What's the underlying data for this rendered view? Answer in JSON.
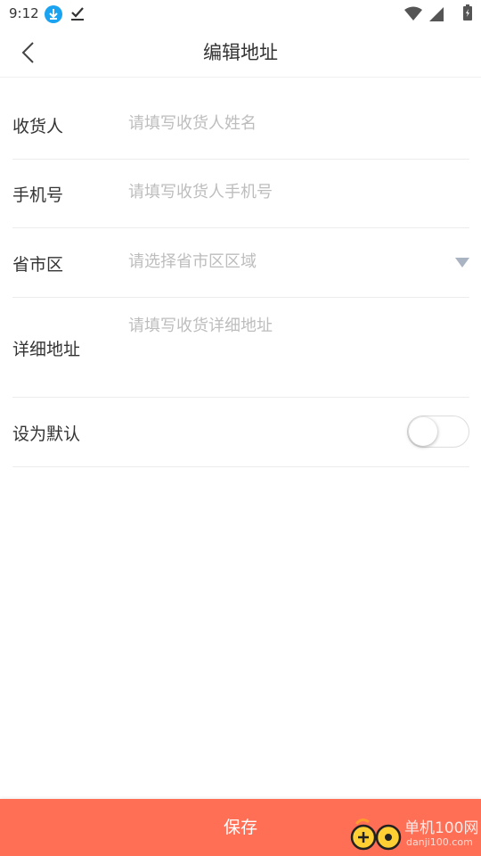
{
  "status_bar": {
    "time": "9:12"
  },
  "header": {
    "title": "编辑地址",
    "back_icon": "chevron-left-icon"
  },
  "form": {
    "receiver": {
      "label": "收货人",
      "value": "",
      "placeholder": "请填写收货人姓名"
    },
    "phone": {
      "label": "手机号",
      "value": "",
      "placeholder": "请填写收货人手机号"
    },
    "region": {
      "label": "省市区",
      "value": "",
      "placeholder": "请选择省市区区域"
    },
    "detail": {
      "label": "详细地址",
      "value": "",
      "placeholder": "请填写收货详细地址"
    },
    "default": {
      "label": "设为默认",
      "checked": false
    }
  },
  "footer": {
    "save_label": "保存"
  },
  "watermark": {
    "text": "单机100网",
    "sub": "danji100.com"
  },
  "colors": {
    "accent": "#ff6f56",
    "placeholder": "#bdbdbd",
    "divider": "#ececec",
    "arrow": "#a9b3c2"
  }
}
